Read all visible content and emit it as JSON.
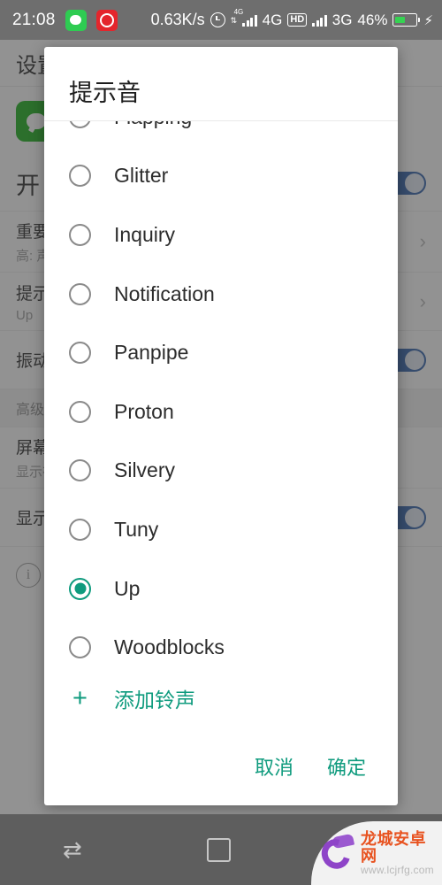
{
  "status_bar": {
    "clock": "21:08",
    "apps": [
      "wechat-icon",
      "netease-music-icon"
    ],
    "net_speed": "0.63K/s",
    "alarm_icon": "alarm-clock-icon",
    "data_arrows_label": "4G",
    "network_1": "4G",
    "hd_badge": "HD",
    "network_2": "3G",
    "battery_percent": "46%",
    "charging_icon": "lightning-bolt-icon"
  },
  "background": {
    "app_bar_title": "设置",
    "app_icon": "wechat-app-icon",
    "switch_color": "#2f5fa8",
    "enable_row": {
      "label": "开"
    },
    "rows": [
      {
        "title": "重要",
        "sub": "高: 声音提示",
        "control": "chevron"
      },
      {
        "title": "提示音",
        "sub": "Up",
        "control": "chevron"
      },
      {
        "title": "振动",
        "sub": "",
        "control": "switch"
      }
    ],
    "section_header": "高级",
    "rows2": [
      {
        "title": "屏幕",
        "sub": "显示在锁屏上",
        "control": ""
      },
      {
        "title": "显示",
        "sub": "",
        "control": "switch"
      }
    ],
    "info_icon": "info-circle-icon"
  },
  "dialog": {
    "title": "提示音",
    "accent_color": "#0f9b7e",
    "options": [
      {
        "label": "Flapping",
        "selected": false
      },
      {
        "label": "Glitter",
        "selected": false
      },
      {
        "label": "Inquiry",
        "selected": false
      },
      {
        "label": "Notification",
        "selected": false
      },
      {
        "label": "Panpipe",
        "selected": false
      },
      {
        "label": "Proton",
        "selected": false
      },
      {
        "label": "Silvery",
        "selected": false
      },
      {
        "label": "Tuny",
        "selected": false
      },
      {
        "label": "Up",
        "selected": true
      },
      {
        "label": "Woodblocks",
        "selected": false
      }
    ],
    "add_ringtone": {
      "icon": "plus-icon",
      "label": "添加铃声"
    },
    "cancel_label": "取消",
    "confirm_label": "确定"
  },
  "nav_bar": {
    "recents_icon": "swap-arrows-icon",
    "home_icon": "home-square-icon",
    "back_icon": "back-arrow-icon"
  },
  "watermark": {
    "name": "龙城安卓网",
    "url": "www.lcjrfg.com"
  }
}
